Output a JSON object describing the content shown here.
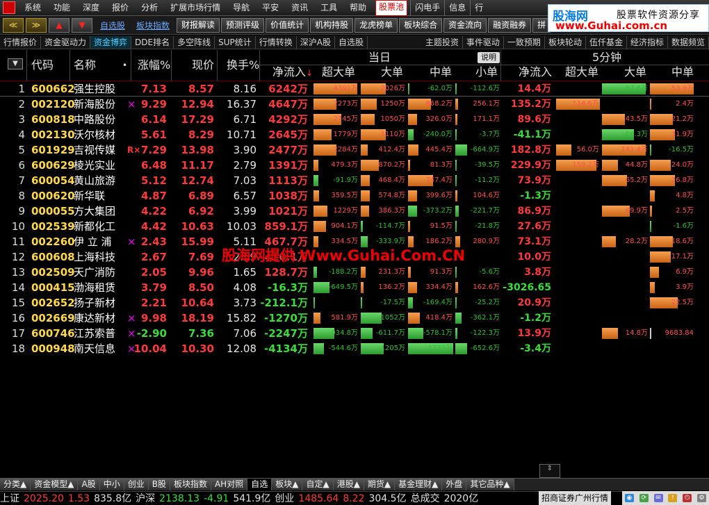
{
  "menu": {
    "items": [
      "系统",
      "功能",
      "深度",
      "报价",
      "分析",
      "扩展市场行情",
      "导航",
      "平安",
      "资讯",
      "工具",
      "帮助"
    ],
    "highlight": "股票池",
    "right": [
      "闪电手",
      "信息",
      "行"
    ]
  },
  "toolbar": {
    "nav": [
      "≪",
      "≫",
      "▲",
      "▼"
    ],
    "links": [
      "自选股",
      "板块指数"
    ],
    "buttons": [
      "财报解读",
      "预测评级",
      "价值统计",
      "机构持股",
      "龙虎榜单",
      "板块综合",
      "资金流向",
      "融资融券",
      "拼"
    ]
  },
  "banner": {
    "site": "股海网",
    "slogan": "股票软件资源分享",
    "url": "www.Guhai.com.cn"
  },
  "tabs2": {
    "left": [
      "行情报价",
      "资金驱动力",
      "资金博弈",
      "DDE排名",
      "多空阵线",
      "SUP统计",
      "行情转换",
      "深沪A股",
      "自选股"
    ],
    "active_index": 2,
    "right": [
      "主题投资",
      "事件驱动",
      "一致预期",
      "板块轮动",
      "伍仟基金",
      "经济指标",
      "数据频览"
    ]
  },
  "header": {
    "menu_icon": "▼",
    "code": "代码",
    "name": "名称",
    "name_dot": "•",
    "change": "涨幅%",
    "price": "现价",
    "turnover": "换手%",
    "group_today": "当日",
    "explain": "说明",
    "group_5min": "5分钟",
    "net_inflow": "净流入",
    "sort_arrow": "↓",
    "super_large": "超大单",
    "large": "大单",
    "medium": "中单",
    "small": "小单",
    "net_inflow_5": "净流入",
    "super_large_5": "超大单",
    "large_5": "大单",
    "medium_5": "中单"
  },
  "rows": [
    {
      "n": "1",
      "code": "600662",
      "name": "强生控股",
      "mark": "",
      "chg": "7.13",
      "price": "8.57",
      "turn": "8.16",
      "net": "6242万",
      "sl": "4391万",
      "lg": "2026万",
      "md": "-62.0万",
      "sm": "-112.6万",
      "net5": "14.4万",
      "sl5": "",
      "lg5": "-87.6万",
      "md5": "53.9万"
    },
    {
      "n": "2",
      "code": "002120",
      "name": "新海股份",
      "mark": "×",
      "chg": "9.29",
      "price": "12.94",
      "turn": "16.37",
      "net": "4647万",
      "sl": "2273万",
      "lg": "1250万",
      "md": "868.2万",
      "sm": "256.1万",
      "net5": "135.2万",
      "sl5": "114.6万",
      "lg5": "",
      "md5": "2.4万"
    },
    {
      "n": "3",
      "code": "600818",
      "name": "中路股份",
      "mark": "",
      "chg": "6.14",
      "price": "17.29",
      "turn": "6.71",
      "net": "4292万",
      "sl": "2745万",
      "lg": "1050万",
      "md": "326.0万",
      "sm": "171.1万",
      "net5": "89.6万",
      "sl5": "",
      "lg5": "43.5万",
      "md5": "21.2万"
    },
    {
      "n": "4",
      "code": "002130",
      "name": "沃尔核材",
      "mark": "",
      "chg": "5.61",
      "price": "8.29",
      "turn": "10.71",
      "net": "2645万",
      "sl": "1779万",
      "lg": "1110万",
      "md": "-240.0万",
      "sm": "-3.7万",
      "net5": "-41.1万",
      "sl5": "",
      "lg5": "-66.3万",
      "md5": "31.9万"
    },
    {
      "n": "5",
      "code": "601929",
      "name": "吉视传媒",
      "mark": "R×",
      "chg": "7.29",
      "price": "13.98",
      "turn": "3.90",
      "net": "2477万",
      "sl": "2284万",
      "lg": "412.4万",
      "md": "445.4万",
      "sm": "-664.9万",
      "net5": "182.8万",
      "sl5": "56.0万",
      "lg5": "141.4万",
      "md5": "-16.5万"
    },
    {
      "n": "6",
      "code": "600629",
      "name": "棱光实业",
      "mark": "",
      "chg": "6.48",
      "price": "11.17",
      "turn": "2.79",
      "net": "1391万",
      "sl": "479.3万",
      "lg": "870.2万",
      "md": "81.3万",
      "sm": "-39.5万",
      "net5": "229.9万",
      "sl5": "159.2万",
      "lg5": "44.8万",
      "md5": "24.0万"
    },
    {
      "n": "7",
      "code": "600054",
      "name": "黄山旅游",
      "mark": "",
      "chg": "5.12",
      "price": "12.74",
      "turn": "7.03",
      "net": "1113万",
      "sl": "-91.9万",
      "lg": "468.4万",
      "md": "747.4万",
      "sm": "-11.2万",
      "net5": "73.9万",
      "sl5": "",
      "lg5": "65.2万",
      "md5": "26.8万"
    },
    {
      "n": "8",
      "code": "000620",
      "name": "新华联",
      "mark": "",
      "chg": "4.87",
      "price": "6.89",
      "turn": "6.57",
      "net": "1038万",
      "sl": "359.5万",
      "lg": "574.8万",
      "md": "399.6万",
      "sm": "104.6万",
      "net5": "-1.3万",
      "sl5": "",
      "lg5": "",
      "md5": "4.8万"
    },
    {
      "n": "9",
      "code": "000055",
      "name": "方大集团",
      "mark": "",
      "chg": "4.22",
      "price": "6.92",
      "turn": "3.99",
      "net": "1021万",
      "sl": "1229万",
      "lg": "386.3万",
      "md": "-373.2万",
      "sm": "-221.7万",
      "net5": "86.9万",
      "sl5": "",
      "lg5": "69.9万",
      "md5": "2.5万"
    },
    {
      "n": "10",
      "code": "002539",
      "name": "新都化工",
      "mark": "",
      "chg": "4.42",
      "price": "10.63",
      "turn": "10.03",
      "net": "859.1万",
      "sl": "904.1万",
      "lg": "-114.7万",
      "md": "91.5万",
      "sm": "-21.8万",
      "net5": "27.6万",
      "sl5": "",
      "lg5": "",
      "md5": "-1.6万"
    },
    {
      "n": "11",
      "code": "002260",
      "name": "伊 立 浦",
      "mark": "×",
      "chg": "2.43",
      "price": "15.99",
      "turn": "5.11",
      "net": "467.7万",
      "sl": "334.5万",
      "lg": "-333.9万",
      "md": "186.2万",
      "sm": "280.9万",
      "net5": "73.1万",
      "sl5": "",
      "lg5": "28.2万",
      "md5": "18.6万"
    },
    {
      "n": "12",
      "code": "600608",
      "name": "上海科技",
      "mark": "",
      "chg": "2.67",
      "price": "7.69",
      "turn": "2.59",
      "net": "420.1万",
      "sl": "",
      "lg": "",
      "md": "",
      "sm": "",
      "net5": "10.0万",
      "sl5": "",
      "lg5": "",
      "md5": "17.1万"
    },
    {
      "n": "13",
      "code": "002509",
      "name": "天广消防",
      "mark": "",
      "chg": "2.05",
      "price": "9.96",
      "turn": "1.65",
      "net": "128.7万",
      "sl": "-188.2万",
      "lg": "231.3万",
      "md": "91.3万",
      "sm": "-5.6万",
      "net5": "3.8万",
      "sl5": "",
      "lg5": "",
      "md5": "6.9万"
    },
    {
      "n": "14",
      "code": "000415",
      "name": "渤海租赁",
      "mark": "",
      "chg": "3.79",
      "price": "8.50",
      "turn": "4.08",
      "net": "-16.3万",
      "sl": "-649.5万",
      "lg": "136.2万",
      "md": "334.4万",
      "sm": "162.6万",
      "net5": "-3026.65",
      "sl5": "",
      "lg5": "",
      "md5": "3.9万"
    },
    {
      "n": "15",
      "code": "002652",
      "name": "扬子新材",
      "mark": "",
      "chg": "2.21",
      "price": "10.64",
      "turn": "3.73",
      "net": "-212.1万",
      "sl": "",
      "lg": "-17.5万",
      "md": "-169.4万",
      "sm": "-25.2万",
      "net5": "20.9万",
      "sl5": "",
      "lg5": "",
      "md5": "22.5万"
    },
    {
      "n": "16",
      "code": "002669",
      "name": "康达新材",
      "mark": "×",
      "chg": "9.98",
      "price": "18.19",
      "turn": "15.82",
      "net": "-1270万",
      "sl": "581.9万",
      "lg": "-1052万",
      "md": "418.4万",
      "sm": "-362.1万",
      "net5": "-1.2万",
      "sl5": "",
      "lg5": "",
      "md5": ""
    },
    {
      "n": "17",
      "code": "600746",
      "name": "江苏索普",
      "mark": "×",
      "chg": "-2.90",
      "price": "7.36",
      "turn": "7.06",
      "net": "-2247万",
      "sl": "-934.8万",
      "lg": "-611.7万",
      "md": "-578.1万",
      "sm": "-122.3万",
      "net5": "13.9万",
      "sl5": "",
      "lg5": "14.8万",
      "md5": "9683.84"
    },
    {
      "n": "18",
      "code": "000948",
      "name": "南天信息",
      "mark": "×",
      "chg": "10.04",
      "price": "10.30",
      "turn": "12.08",
      "net": "-4134万",
      "sl": "-544.6万",
      "lg": "-1205万",
      "md": "-1732万",
      "sm": "-652.6万",
      "net5": "-3.4万",
      "sl5": "",
      "lg5": "",
      "md5": ""
    }
  ],
  "bars": [
    {
      "sl": [
        0.95,
        "o"
      ],
      "lg": [
        0.55,
        "o"
      ],
      "md": [
        0.03,
        "g"
      ],
      "sm": [
        0.03,
        "g"
      ],
      "sl5": [
        0,
        ""
      ],
      "lg5": [
        0.95,
        "g"
      ],
      "md5": [
        0.95,
        "o"
      ]
    },
    {
      "sl": [
        0.5,
        "o"
      ],
      "lg": [
        0.35,
        "o"
      ],
      "md": [
        0.5,
        "o"
      ],
      "sm": [
        0.06,
        "o"
      ],
      "sl5": [
        0.98,
        "o"
      ],
      "lg5": [
        0,
        ""
      ],
      "md5": [
        0.03,
        "o"
      ]
    },
    {
      "sl": [
        0.6,
        "o"
      ],
      "lg": [
        0.3,
        "o"
      ],
      "md": [
        0.2,
        "o"
      ],
      "sm": [
        0.04,
        "o"
      ],
      "sl5": [
        0,
        ""
      ],
      "lg5": [
        0.5,
        "o"
      ],
      "md5": [
        0.5,
        "o"
      ]
    },
    {
      "sl": [
        0.4,
        "o"
      ],
      "lg": [
        0.55,
        "o"
      ],
      "md": [
        0.12,
        "g"
      ],
      "sm": [
        0.02,
        "g"
      ],
      "sl5": [
        0,
        ""
      ],
      "lg5": [
        0.7,
        "g"
      ],
      "md5": [
        0.55,
        "o"
      ]
    },
    {
      "sl": [
        0.5,
        "o"
      ],
      "lg": [
        0.15,
        "o"
      ],
      "md": [
        0.22,
        "o"
      ],
      "sm": [
        0.25,
        "g"
      ],
      "sl5": [
        0.35,
        "o"
      ],
      "lg5": [
        0.95,
        "o"
      ],
      "md5": [
        0.03,
        "g"
      ]
    },
    {
      "sl": [
        0.1,
        "o"
      ],
      "lg": [
        0.4,
        "o"
      ],
      "md": [
        0.05,
        "o"
      ],
      "sm": [
        0.02,
        "g"
      ],
      "sl5": [
        0.9,
        "o"
      ],
      "lg5": [
        0.35,
        "o"
      ],
      "md5": [
        0.45,
        "o"
      ]
    },
    {
      "sl": [
        0.1,
        "g"
      ],
      "lg": [
        0.2,
        "o"
      ],
      "md": [
        0.55,
        "o"
      ],
      "sm": [
        0.02,
        "g"
      ],
      "sl5": [
        0,
        ""
      ],
      "lg5": [
        0.55,
        "o"
      ],
      "md5": [
        0.55,
        "o"
      ]
    },
    {
      "sl": [
        0.12,
        "o"
      ],
      "lg": [
        0.2,
        "o"
      ],
      "md": [
        0.2,
        "o"
      ],
      "sm": [
        0.04,
        "o"
      ],
      "sl5": [
        0,
        ""
      ],
      "lg5": [
        0,
        ""
      ],
      "md5": [
        0.1,
        "o"
      ]
    },
    {
      "sl": [
        0.3,
        "o"
      ],
      "lg": [
        0.18,
        "o"
      ],
      "md": [
        0.2,
        "g"
      ],
      "sm": [
        0.08,
        "g"
      ],
      "sl5": [
        0,
        ""
      ],
      "lg5": [
        0.6,
        "o"
      ],
      "md5": [
        0.05,
        "o"
      ]
    },
    {
      "sl": [
        0.28,
        "o"
      ],
      "lg": [
        0.05,
        "g"
      ],
      "md": [
        0.04,
        "o"
      ],
      "sm": [
        0.01,
        "g"
      ],
      "sl5": [
        0,
        ""
      ],
      "lg5": [
        0,
        ""
      ],
      "md5": [
        0.03,
        "g"
      ]
    },
    {
      "sl": [
        0.1,
        "o"
      ],
      "lg": [
        0.15,
        "g"
      ],
      "md": [
        0.12,
        "o"
      ],
      "sm": [
        0.1,
        "o"
      ],
      "sl5": [
        0,
        ""
      ],
      "lg5": [
        0.3,
        "o"
      ],
      "md5": [
        0.5,
        "o"
      ]
    },
    {
      "sl": [
        0,
        ""
      ],
      "lg": [
        0,
        ""
      ],
      "md": [
        0,
        ""
      ],
      "sm": [
        0,
        ""
      ],
      "sl5": [
        0,
        ""
      ],
      "lg5": [
        0,
        ""
      ],
      "md5": [
        0.45,
        "o"
      ]
    },
    {
      "sl": [
        0.08,
        "g"
      ],
      "lg": [
        0.1,
        "o"
      ],
      "md": [
        0.06,
        "o"
      ],
      "sm": [
        0.01,
        "g"
      ],
      "sl5": [
        0,
        ""
      ],
      "lg5": [
        0,
        ""
      ],
      "md5": [
        0.2,
        "o"
      ]
    },
    {
      "sl": [
        0.35,
        "g"
      ],
      "lg": [
        0.06,
        "o"
      ],
      "md": [
        0.2,
        "o"
      ],
      "sm": [
        0.06,
        "o"
      ],
      "sl5": [
        0,
        ""
      ],
      "lg5": [
        0,
        ""
      ],
      "md5": [
        0.1,
        "o"
      ]
    },
    {
      "sl": [
        0.01,
        "g"
      ],
      "lg": [
        0.01,
        "g"
      ],
      "md": [
        0.1,
        "g"
      ],
      "sm": [
        0.01,
        "g"
      ],
      "sl5": [
        0,
        ""
      ],
      "lg5": [
        0,
        ""
      ],
      "md5": [
        0.6,
        "o"
      ]
    },
    {
      "sl": [
        0.15,
        "o"
      ],
      "lg": [
        0.45,
        "g"
      ],
      "md": [
        0.25,
        "o"
      ],
      "sm": [
        0.14,
        "g"
      ],
      "sl5": [
        0,
        ""
      ],
      "lg5": [
        0,
        ""
      ],
      "md5": [
        0,
        ""
      ]
    },
    {
      "sl": [
        0.45,
        "g"
      ],
      "lg": [
        0.25,
        "g"
      ],
      "md": [
        0.33,
        "g"
      ],
      "sm": [
        0.05,
        "g"
      ],
      "sl5": [
        0,
        ""
      ],
      "lg5": [
        0.35,
        "o"
      ],
      "md5": [
        0,
        ""
      ]
    },
    {
      "sl": [
        0.22,
        "g"
      ],
      "lg": [
        0.5,
        "g"
      ],
      "md": [
        0.98,
        "g"
      ],
      "sm": [
        0.25,
        "g"
      ],
      "sl5": [
        0,
        ""
      ],
      "lg5": [
        0,
        ""
      ],
      "md5": [
        0,
        ""
      ]
    }
  ],
  "watermark": "股海网提供 Www.Guhai.Com.CN",
  "bottom_tabs": [
    "分类▲",
    "资金模型▲",
    "A股",
    "中小",
    "创业",
    "B股",
    "板块指数",
    "AH对照",
    "自选",
    "板块▲",
    "自定▲",
    "港股▲",
    "期货▲",
    "基金理财▲",
    "外盘",
    "其它品种▲"
  ],
  "bottom_active": 8,
  "status": {
    "sh_label": "上证",
    "sh_val": "2025.20",
    "sh_chg": "1.53",
    "sh_amt": "835.8亿",
    "hs_label": "沪深",
    "hs_val": "2138.13",
    "hs_chg": "-4.91",
    "hs_amt": "541.9亿",
    "cy_label": "创业",
    "cy_val": "1485.64",
    "cy_chg": "8.22",
    "cy_amt": "304.5亿",
    "total_label": "总成交",
    "total_amt": "2020亿",
    "broker": "招商证券广州行情"
  },
  "colors": {
    "up": "#ff3b3b",
    "down": "#3bdc3b",
    "code": "#ffd84a",
    "bar_up": "#e08a30",
    "bar_down": "#3cb83c"
  }
}
